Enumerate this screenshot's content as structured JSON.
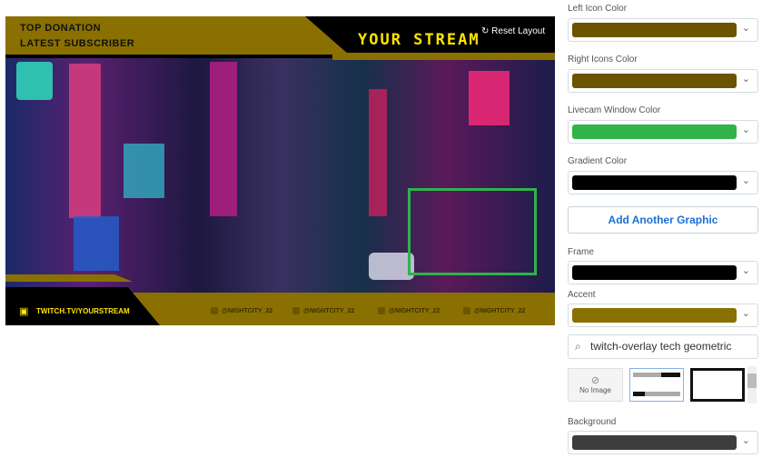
{
  "overlay": {
    "top_donation": "TOP DONATION",
    "latest_subscriber": "LATEST SUBSCRIBER",
    "title": "YOUR STREAM",
    "reset_layout": "Reset Layout",
    "twitch_url": "TWITCH.TV/YOURSTREAM",
    "socials": [
      {
        "icon": "facebook-icon",
        "handle": "@NIGHTCITY_22"
      },
      {
        "icon": "twitter-icon",
        "handle": "@NIGHTCITY_22"
      },
      {
        "icon": "youtube-icon",
        "handle": "@NIGHTCITY_22"
      },
      {
        "icon": "discord-icon",
        "handle": "@NIGHTCITY_22"
      }
    ]
  },
  "panel": {
    "left_icon_color": {
      "label": "Left Icon Color",
      "value": "#6b5300"
    },
    "right_icons_color": {
      "label": "Right Icons Color",
      "value": "#6b5300"
    },
    "livecam_window_color": {
      "label": "Livecam Window Color",
      "value": "#2fb34a"
    },
    "gradient_color": {
      "label": "Gradient Color",
      "value": "#000000"
    },
    "add_graphic": "Add Another Graphic",
    "frame": {
      "label": "Frame",
      "value": "#000000"
    },
    "accent": {
      "label": "Accent",
      "value": "#8a7000"
    },
    "search_value": "twitch-overlay tech geometric",
    "no_image": "No Image",
    "background": {
      "label": "Background",
      "value": "#3d3d3d"
    }
  }
}
